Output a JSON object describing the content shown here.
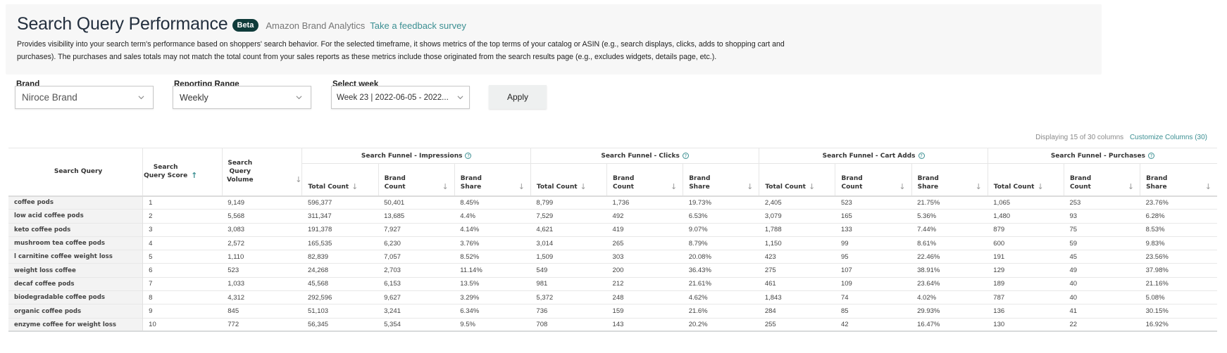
{
  "header": {
    "title": "Search Query Performance",
    "badge": "Beta",
    "subtitle": "Amazon Brand Analytics",
    "feedback_link": "Take a feedback survey",
    "description_line1": "Provides visibility into your search term's performance based on shoppers' search behavior. For the selected timeframe, it shows metrics of the top terms of your catalog or ASIN (e.g., search displays, clicks, adds to shopping cart and",
    "description_line2": "purchases). The purchases and sales totals may not match the total count from your sales reports as these metrics include those originated from the search results page (e.g., excludes widgets, details page, etc.)."
  },
  "filters": {
    "brand": {
      "label": "Brand",
      "value": "Niroce Brand"
    },
    "reporting_range": {
      "label": "Reporting Range",
      "value": "Weekly"
    },
    "select_week": {
      "label": "Select week",
      "value": "Week 23 | 2022-06-05 - 2022..."
    },
    "apply_label": "Apply"
  },
  "columns_info": {
    "count_text": "Displaying 15 of 30 columns",
    "customize_label": "Customize Columns (30)"
  },
  "table": {
    "groups": [
      {
        "label": "Search Funnel - Impressions"
      },
      {
        "label": "Search Funnel - Clicks"
      },
      {
        "label": "Search Funnel - Cart Adds"
      },
      {
        "label": "Search Funnel - Purchases"
      }
    ],
    "columns": {
      "query": "Search Query",
      "score": "Search Query Score",
      "volume": "Search Query Volume",
      "total_count": "Total Count",
      "brand_count": "Brand Count",
      "brand_share": "Brand Share"
    },
    "rows": [
      {
        "query": "coffee pods",
        "score": "1",
        "volume": "9,149",
        "cells": [
          "596,377",
          "50,401",
          "8.45%",
          "8,799",
          "1,736",
          "19.73%",
          "2,405",
          "523",
          "21.75%",
          "1,065",
          "253",
          "23.76%"
        ]
      },
      {
        "query": "low acid coffee pods",
        "score": "2",
        "volume": "5,568",
        "cells": [
          "311,347",
          "13,685",
          "4.4%",
          "7,529",
          "492",
          "6.53%",
          "3,079",
          "165",
          "5.36%",
          "1,480",
          "93",
          "6.28%"
        ]
      },
      {
        "query": "keto coffee pods",
        "score": "3",
        "volume": "3,083",
        "cells": [
          "191,378",
          "7,927",
          "4.14%",
          "4,621",
          "419",
          "9.07%",
          "1,788",
          "133",
          "7.44%",
          "879",
          "75",
          "8.53%"
        ]
      },
      {
        "query": "mushroom tea coffee pods",
        "score": "4",
        "volume": "2,572",
        "cells": [
          "165,535",
          "6,230",
          "3.76%",
          "3,014",
          "265",
          "8.79%",
          "1,150",
          "99",
          "8.61%",
          "600",
          "59",
          "9.83%"
        ]
      },
      {
        "query": "l carnitine coffee weight loss",
        "score": "5",
        "volume": "1,110",
        "cells": [
          "82,839",
          "7,057",
          "8.52%",
          "1,509",
          "303",
          "20.08%",
          "423",
          "95",
          "22.46%",
          "191",
          "45",
          "23.56%"
        ]
      },
      {
        "query": "weight loss coffee",
        "score": "6",
        "volume": "523",
        "cells": [
          "24,268",
          "2,703",
          "11.14%",
          "549",
          "200",
          "36.43%",
          "275",
          "107",
          "38.91%",
          "129",
          "49",
          "37.98%"
        ]
      },
      {
        "query": "decaf coffee pods",
        "score": "7",
        "volume": "1,033",
        "cells": [
          "45,568",
          "6,153",
          "13.5%",
          "981",
          "212",
          "21.61%",
          "461",
          "109",
          "23.64%",
          "189",
          "40",
          "21.16%"
        ]
      },
      {
        "query": "biodegradable coffee pods",
        "score": "8",
        "volume": "4,312",
        "cells": [
          "292,596",
          "9,627",
          "3.29%",
          "5,372",
          "248",
          "4.62%",
          "1,843",
          "74",
          "4.02%",
          "787",
          "40",
          "5.08%"
        ]
      },
      {
        "query": "organic coffee pods",
        "score": "9",
        "volume": "845",
        "cells": [
          "51,103",
          "3,241",
          "6.34%",
          "736",
          "159",
          "21.6%",
          "284",
          "85",
          "29.93%",
          "136",
          "41",
          "30.15%"
        ]
      },
      {
        "query": "enzyme coffee for weight loss",
        "score": "10",
        "volume": "772",
        "cells": [
          "56,345",
          "5,354",
          "9.5%",
          "708",
          "143",
          "20.2%",
          "255",
          "42",
          "16.47%",
          "130",
          "22",
          "16.92%"
        ]
      }
    ]
  },
  "icons": {
    "sort_asc": "↑",
    "sort_desc": "↓",
    "help": "?",
    "chevron": "chevron-down"
  },
  "colors": {
    "accent": "#3b8f92",
    "badge": "#0f3b3a",
    "title": "#232f3e"
  }
}
